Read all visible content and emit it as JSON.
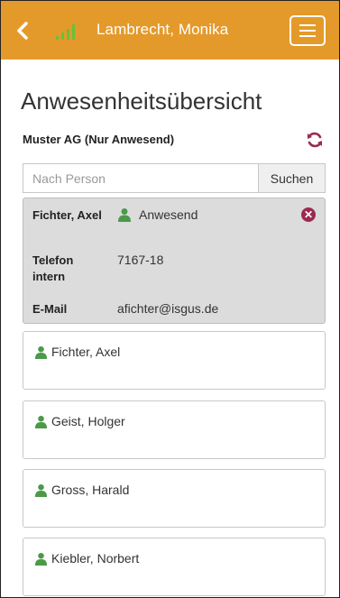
{
  "header": {
    "title": "Lambrecht, Monika",
    "back_icon": "chevron-left-icon",
    "signal_icon": "signal-bars-icon",
    "menu_icon": "hamburger-menu-icon",
    "accent": "#e49a2a"
  },
  "page": {
    "title": "Anwesenheitsübersicht",
    "subtitle": "Muster AG (Nur Anwesend)",
    "refresh_icon": "refresh-icon"
  },
  "search": {
    "placeholder": "Nach Person",
    "button_label": "Suchen"
  },
  "detail": {
    "name": "Fichter, Axel",
    "status": "Anwesend",
    "phone_label": "Telefon intern",
    "phone_value": "7167-18",
    "email_label": "E-Mail",
    "email_value": "afichter@isgus.de"
  },
  "people": [
    {
      "name": "Fichter, Axel"
    },
    {
      "name": "Geist, Holger"
    },
    {
      "name": "Gross, Harald"
    },
    {
      "name": "Kiebler, Norbert"
    }
  ],
  "colors": {
    "present_green": "#4a9a48",
    "close_red": "#9b2a50"
  }
}
